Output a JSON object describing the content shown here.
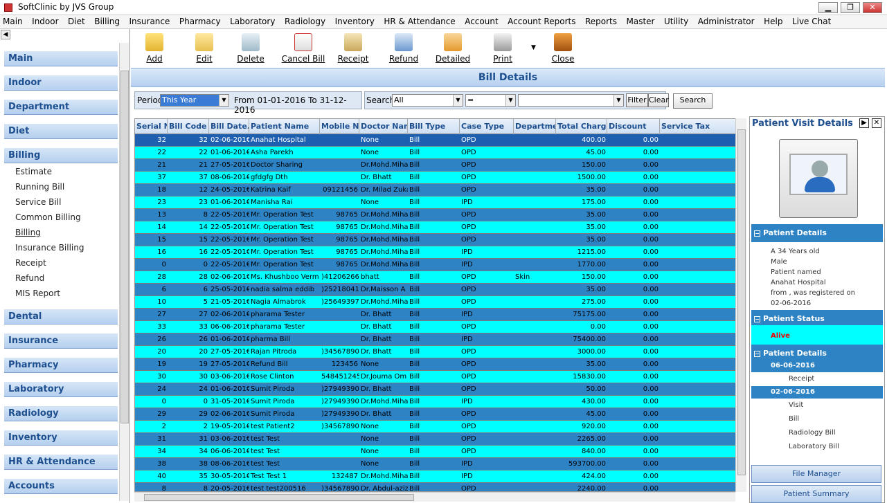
{
  "window": {
    "title": "SoftClinic by JVS Group",
    "min": "▁",
    "max": "❐",
    "close": "✕"
  },
  "menu": [
    "Main",
    "Indoor",
    "Diet",
    "Billing",
    "Insurance",
    "Pharmacy",
    "Laboratory",
    "Radiology",
    "Inventory",
    "HR & Attendance",
    "Account",
    "Account Reports",
    "Reports",
    "Master",
    "Utility",
    "Administrator",
    "Help",
    "Live Chat"
  ],
  "sidebar": {
    "back": "◀",
    "groups_top": [
      "Main",
      "Indoor",
      "Department",
      "Diet",
      "Billing"
    ],
    "billing_items": [
      "Estimate",
      "Running Bill",
      "Service Bill",
      "Common Billing",
      "Billing",
      "Insurance Billing",
      "Receipt",
      "Refund",
      "MIS Report"
    ],
    "groups_bottom": [
      "Dental",
      "Insurance",
      "Pharmacy",
      "Laboratory",
      "Radiology",
      "Inventory",
      "HR & Attendance",
      "Accounts"
    ]
  },
  "toolbar": {
    "add": "Add",
    "edit": "Edit",
    "delete": "Delete",
    "cancel_bill": "Cancel Bill",
    "receipt": "Receipt",
    "refund": "Refund",
    "detailed": "Detailed",
    "print": "Print",
    "close": "Close"
  },
  "page_title": "Bill Details",
  "filter": {
    "period_label": "Period",
    "period_value": "This Year",
    "range_text": "From  01-01-2016 To 31-12-2016",
    "search_label": "Search",
    "search_field": "All",
    "operator": "=",
    "search_value": "",
    "filter_btn": "Filter",
    "clear_btn": "Clear",
    "search_btn": "Search"
  },
  "grid": {
    "columns": [
      "Serial N",
      "Bill Code",
      "Bill Date.",
      "Patient Name",
      "Mobile Nc",
      "Doctor Nam",
      "Bill Type",
      "Case Type",
      "Departme",
      "Total Charge",
      "Discount",
      "Service Tax"
    ],
    "rows": [
      [
        "32",
        "32",
        "02-06-201€",
        "Anahat Hospital",
        "",
        "None",
        "Bill",
        "OPD",
        "",
        "400.00",
        "0.00"
      ],
      [
        "22",
        "22",
        "01-06-201€",
        "Asha Parekh",
        "",
        "None",
        "Bill",
        "OPD",
        "",
        "45.00",
        "0.00"
      ],
      [
        "21",
        "21",
        "27-05-201€",
        "Doctor Sharing",
        "",
        "Dr.Mohd.Miha",
        "Bill",
        "OPD",
        "",
        "150.00",
        "0.00"
      ],
      [
        "37",
        "37",
        "08-06-201€",
        "gfdgfg Dth",
        "",
        "Dr. Bhatt",
        "Bill",
        "OPD",
        "",
        "1500.00",
        "0.00"
      ],
      [
        "18",
        "12",
        "24-05-201€",
        "Katrina Kaif",
        "09121456",
        "Dr. Milad Zuka",
        "Bill",
        "OPD",
        "",
        "35.00",
        "0.00"
      ],
      [
        "23",
        "23",
        "01-06-201€",
        "Manisha Rai",
        "",
        "None",
        "Bill",
        "IPD",
        "",
        "175.00",
        "0.00"
      ],
      [
        "13",
        "8",
        "22-05-201€",
        "Mr. Operation Test",
        "98765",
        "Dr.Mohd.Miha",
        "Bill",
        "OPD",
        "",
        "35.00",
        "0.00"
      ],
      [
        "14",
        "14",
        "22-05-201€",
        "Mr. Operation Test",
        "98765",
        "Dr.Mohd.Miha",
        "Bill",
        "OPD",
        "",
        "35.00",
        "0.00"
      ],
      [
        "15",
        "15",
        "22-05-201€",
        "Mr. Operation Test",
        "98765",
        "Dr.Mohd.Miha",
        "Bill",
        "OPD",
        "",
        "35.00",
        "0.00"
      ],
      [
        "16",
        "16",
        "22-05-201€",
        "Mr. Operation Test",
        "98765",
        "Dr.Mohd.Miha",
        "Bill",
        "IPD",
        "",
        "1215.00",
        "0.00"
      ],
      [
        "0",
        "0",
        "22-05-201€",
        "Mr. Operation Test",
        "98765",
        "Dr.Mohd.Miha",
        "Bill",
        "IPD",
        "",
        "1770.00",
        "0.00"
      ],
      [
        "28",
        "28",
        "02-06-201€",
        "Ms. Khushboo Verm",
        ")41206266",
        "bhatt",
        "Bill",
        "OPD",
        "Skin",
        "150.00",
        "0.00"
      ],
      [
        "6",
        "6",
        "25-05-201€",
        "nadia salma eddib",
        ")25218041",
        "Dr.Maisson A",
        "Bill",
        "OPD",
        "",
        "35.00",
        "0.00"
      ],
      [
        "10",
        "5",
        "21-05-201€",
        "Nagia Almabrok",
        ")25649397",
        "Dr.Mohd.Miha",
        "Bill",
        "OPD",
        "",
        "275.00",
        "0.00"
      ],
      [
        "27",
        "27",
        "02-06-201€",
        "pharama Tester",
        "",
        "Dr. Bhatt",
        "Bill",
        "IPD",
        "",
        "75175.00",
        "0.00"
      ],
      [
        "33",
        "33",
        "06-06-201€",
        "pharama Tester",
        "",
        "Dr. Bhatt",
        "Bill",
        "OPD",
        "",
        "0.00",
        "0.00"
      ],
      [
        "26",
        "26",
        "01-06-201€",
        "pharma Bill",
        "",
        "Dr. Bhatt",
        "Bill",
        "IPD",
        "",
        "75400.00",
        "0.00"
      ],
      [
        "20",
        "20",
        "27-05-201€",
        "Rajan Pitroda",
        ")34567890",
        "Dr. Bhatt",
        "Bill",
        "OPD",
        "",
        "3000.00",
        "0.00"
      ],
      [
        "19",
        "19",
        "27-05-201€",
        "Refund Bill",
        "123456",
        "None",
        "Bill",
        "OPD",
        "",
        "35.00",
        "0.00"
      ],
      [
        "30",
        "30",
        "03-06-201€",
        "Rose Clinton",
        "548451245",
        "Dr.Jouma Om",
        "Bill",
        "OPD",
        "",
        "15830.00",
        "0.00"
      ],
      [
        "24",
        "24",
        "01-06-201€",
        "Sumit Piroda",
        ")27949390",
        "Dr. Bhatt",
        "Bill",
        "OPD",
        "",
        "50.00",
        "0.00"
      ],
      [
        "0",
        "0",
        "31-05-201€",
        "Sumit Piroda",
        ")27949390",
        "Dr.Mohd.Miha",
        "Bill",
        "IPD",
        "",
        "430.00",
        "0.00"
      ],
      [
        "29",
        "29",
        "02-06-201€",
        "Sumit Piroda",
        ")27949390",
        "Dr. Bhatt",
        "Bill",
        "OPD",
        "",
        "45.00",
        "0.00"
      ],
      [
        "2",
        "2",
        "19-05-201€",
        "test Patient2",
        ")34567890",
        "None",
        "Bill",
        "OPD",
        "",
        "920.00",
        "0.00"
      ],
      [
        "31",
        "31",
        "03-06-201€",
        "test Test",
        "",
        "None",
        "Bill",
        "OPD",
        "",
        "2265.00",
        "0.00"
      ],
      [
        "34",
        "34",
        "06-06-201€",
        "test Test",
        "",
        "None",
        "Bill",
        "OPD",
        "",
        "840.00",
        "0.00"
      ],
      [
        "38",
        "38",
        "08-06-201€",
        "test Test",
        "",
        "None",
        "Bill",
        "IPD",
        "",
        "593700.00",
        "0.00"
      ],
      [
        "40",
        "35",
        "30-05-201€",
        "Test Test 1",
        "132487",
        "Dr.Mohd.Miha",
        "Bill",
        "IPD",
        "",
        "424.00",
        "0.00"
      ],
      [
        "8",
        "8",
        "20-05-201€",
        "test test200516",
        ")34567890",
        "Dr. Abdul-aziz",
        "Bill",
        "OPD",
        "",
        "2240.00",
        "0.00"
      ]
    ]
  },
  "patient_panel": {
    "title": "Patient Visit Details",
    "pin": "▶",
    "close": "✕",
    "details_header": "Patient Details",
    "details_lines": [
      "A 34 Years old",
      "Male",
      "Patient named",
      "Anahat Hospital",
      " from , was registered on",
      "02-06-2016"
    ],
    "status_header": "Patient Status",
    "status": "Alive",
    "details2_header": "Patient Details",
    "visit1_date": "06-06-2016",
    "visit1_items": [
      "Receipt"
    ],
    "visit2_date": "02-06-2016",
    "visit2_items": [
      "Visit",
      "Bill",
      "Radiology Bill",
      "Laboratory Bill"
    ],
    "file_manager": "File Manager",
    "patient_summary": "Patient Summary"
  },
  "colors": {
    "row_odd": "#2e83c5",
    "row_even": "#00ffff",
    "row_selected": "#1f5fb0",
    "accent": "#1e4f8f"
  }
}
